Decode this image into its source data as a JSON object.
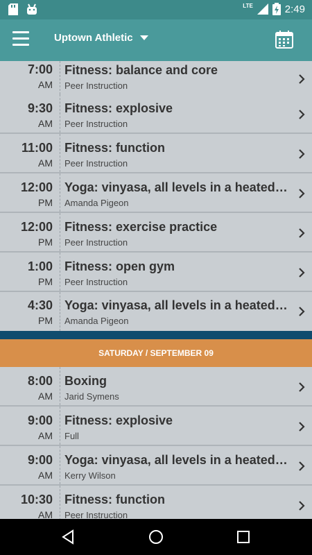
{
  "status": {
    "network": "LTE",
    "time": "2:49"
  },
  "header": {
    "gym": "Uptown Athletic"
  },
  "classes_top": [
    {
      "time": "7:00",
      "ampm": "AM",
      "title": "Fitness: balance and core",
      "instructor": "Peer Instruction"
    },
    {
      "time": "9:30",
      "ampm": "AM",
      "title": "Fitness: explosive",
      "instructor": "Peer Instruction"
    },
    {
      "time": "11:00",
      "ampm": "AM",
      "title": "Fitness: function",
      "instructor": "Peer Instruction"
    },
    {
      "time": "12:00",
      "ampm": "PM",
      "title": "Yoga: vinyasa, all levels in a heated…",
      "instructor": "Amanda Pigeon"
    },
    {
      "time": "12:00",
      "ampm": "PM",
      "title": "Fitness: exercise practice",
      "instructor": "Peer Instruction"
    },
    {
      "time": "1:00",
      "ampm": "PM",
      "title": "Fitness: open gym",
      "instructor": "Peer Instruction"
    },
    {
      "time": "4:30",
      "ampm": "PM",
      "title": "Yoga: vinyasa, all levels in a heated…",
      "instructor": "Amanda Pigeon"
    }
  ],
  "day_header": "SATURDAY / SEPTEMBER 09",
  "classes_bottom": [
    {
      "time": "8:00",
      "ampm": "AM",
      "title": "Boxing",
      "instructor": "Jarid Symens"
    },
    {
      "time": "9:00",
      "ampm": "AM",
      "title": "Fitness: explosive",
      "instructor": "Full"
    },
    {
      "time": "9:00",
      "ampm": "AM",
      "title": "Yoga: vinyasa, all levels in a heated…",
      "instructor": "Kerry Wilson"
    },
    {
      "time": "10:30",
      "ampm": "AM",
      "title": "Fitness: function",
      "instructor": "Peer Instruction"
    }
  ],
  "colors": {
    "statusbar": "#3d8a8a",
    "appbar": "#4a9a9b",
    "day_header": "#d88f4a",
    "divider": "#0f4c6e"
  },
  "icons": [
    "sd-card-icon",
    "android-icon",
    "signal-icon",
    "battery-icon",
    "menu-icon",
    "dropdown-caret-icon",
    "calendar-icon",
    "chevron-right-icon",
    "back-icon",
    "home-icon",
    "recents-icon"
  ]
}
